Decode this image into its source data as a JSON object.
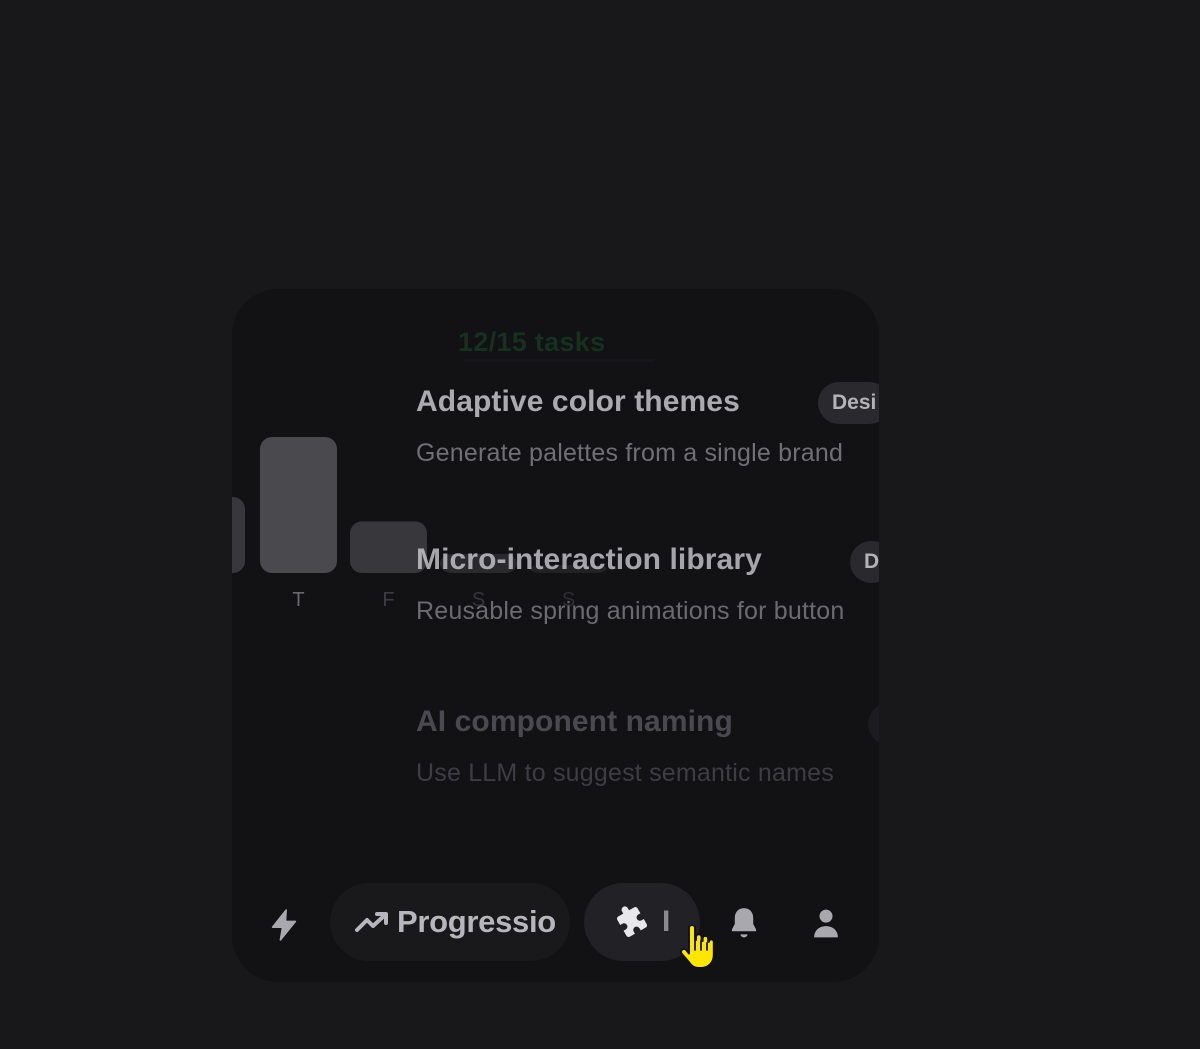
{
  "progress_header": {
    "tasks": "12/15 tasks"
  },
  "chart_data": {
    "type": "bar",
    "categories": [
      "T",
      "F",
      "S",
      "S"
    ],
    "values": [
      100,
      38,
      14,
      0
    ],
    "ylim": [
      0,
      100
    ],
    "grid": false
  },
  "features": [
    {
      "title": "Adaptive color themes",
      "description": "Generate palettes from a single brand",
      "tag": "Desi"
    },
    {
      "title": "Micro-interaction library",
      "description": "Reusable spring animations for button",
      "tag": "D"
    },
    {
      "title": "AI component naming",
      "description": "Use LLM to suggest semantic names",
      "tag": ""
    }
  ],
  "nav": {
    "progression_label": "Progressio",
    "active_label": "I",
    "icons": {
      "bolt": "bolt-icon",
      "trend": "trending-up-icon",
      "puzzle": "puzzle-icon",
      "bell": "bell-icon",
      "user": "user-icon"
    }
  },
  "colors": {
    "background": "#18171a",
    "card": "#121114",
    "accent_green": "#16311f",
    "cursor": "#ffe600"
  }
}
